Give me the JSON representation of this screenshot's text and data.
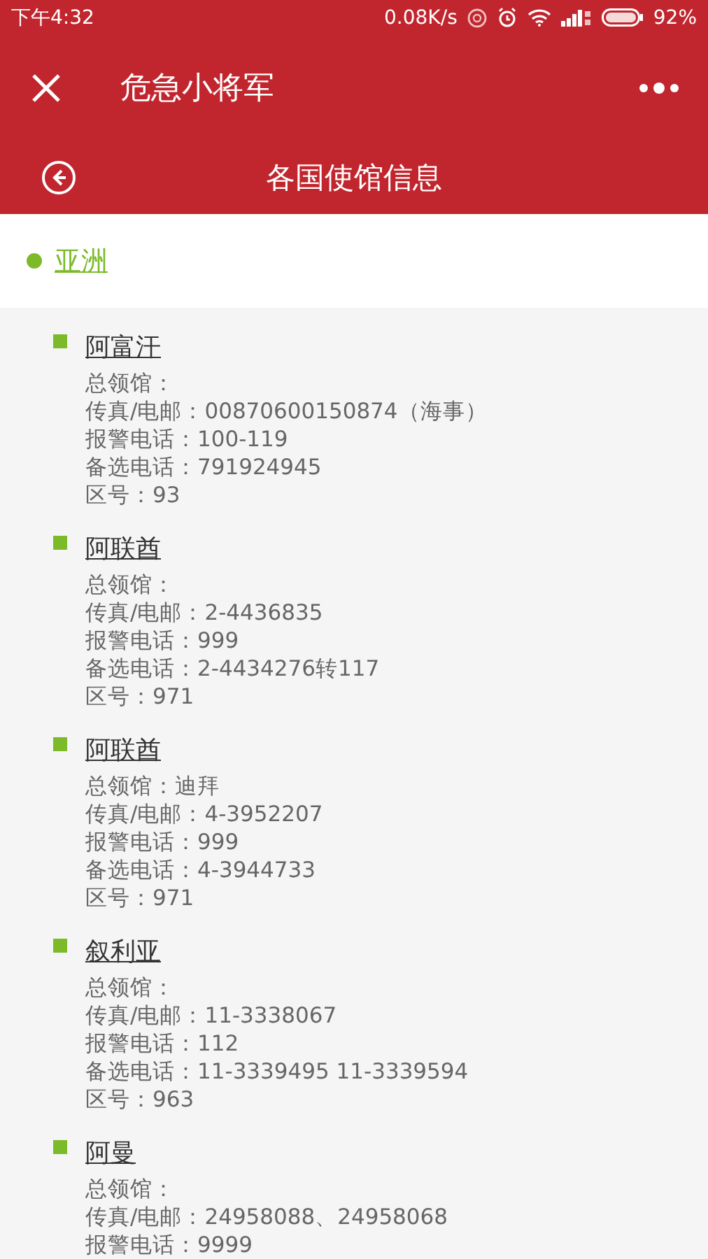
{
  "status_bar": {
    "time": "下午4:32",
    "speed": "0.08K/s",
    "battery": "92%"
  },
  "app_bar": {
    "title": "危急小将军"
  },
  "page_header": {
    "title": "各国使馆信息"
  },
  "region": {
    "name": "亚洲"
  },
  "embassies": [
    {
      "name": "阿富汗",
      "lines": [
        "总领馆：",
        "传真/电邮：00870600150874（海事）",
        "报警电话：100-119",
        "备选电话：791924945",
        "区号：93"
      ]
    },
    {
      "name": "阿联酋",
      "lines": [
        "总领馆：",
        "传真/电邮：2-4436835",
        "报警电话：999",
        "备选电话：2-4434276转117",
        "区号：971"
      ]
    },
    {
      "name": "阿联酋",
      "lines": [
        "总领馆：迪拜",
        "传真/电邮：4-3952207",
        "报警电话：999",
        "备选电话：4-3944733",
        "区号：971"
      ]
    },
    {
      "name": "叙利亚",
      "lines": [
        "总领馆：",
        "传真/电邮：11-3338067",
        "报警电话：112",
        "备选电话：11-3339495 11-3339594",
        "区号：963"
      ]
    },
    {
      "name": "阿曼",
      "lines": [
        "总领馆：",
        "传真/电邮：24958088、24958068",
        "报警电话：9999"
      ]
    }
  ]
}
